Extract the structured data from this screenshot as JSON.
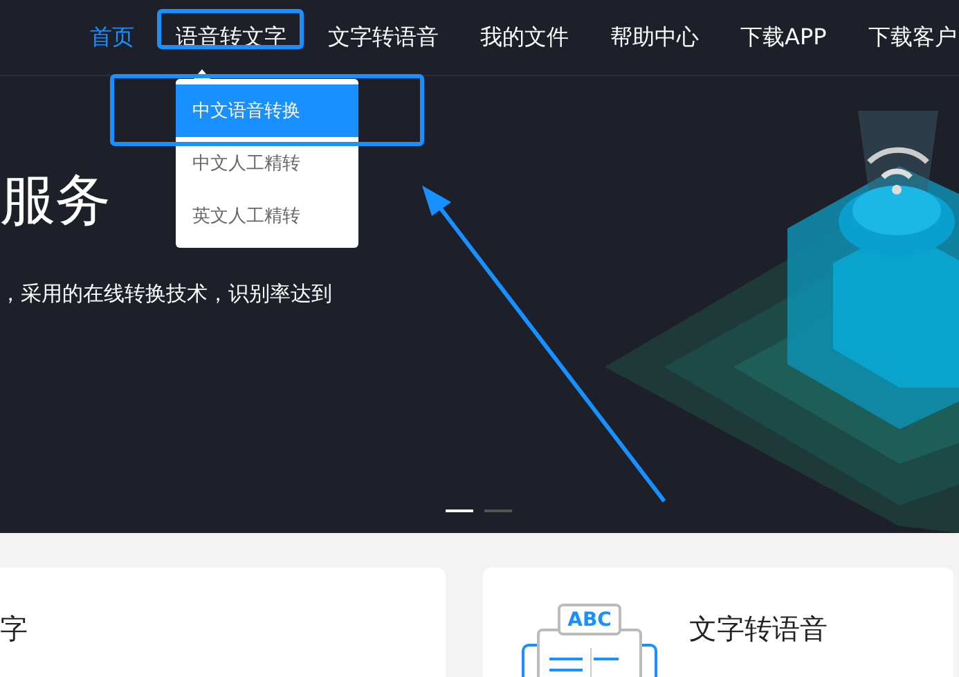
{
  "nav": {
    "items": [
      {
        "label": "首页",
        "selected": true
      },
      {
        "label": "语音转文字",
        "selected": false
      },
      {
        "label": "文字转语音",
        "selected": false
      },
      {
        "label": "我的文件",
        "selected": false
      },
      {
        "label": "帮助中心",
        "selected": false
      },
      {
        "label": "下载APP",
        "selected": false
      },
      {
        "label": "下载客户",
        "selected": false
      }
    ]
  },
  "dropdown": {
    "items": [
      {
        "label": "中文语音转换",
        "selected": true
      },
      {
        "label": "中文人工精转",
        "selected": false
      },
      {
        "label": "英文人工精转",
        "selected": false
      }
    ]
  },
  "hero": {
    "title": "服务",
    "text": "，采用的在线转换技术，识别率达到"
  },
  "carousel_dots": [
    {
      "selected": true
    },
    {
      "selected": false
    }
  ],
  "cards": [
    {
      "title": "字"
    },
    {
      "title": "文字转语音",
      "icon_text": "ABC"
    }
  ]
}
